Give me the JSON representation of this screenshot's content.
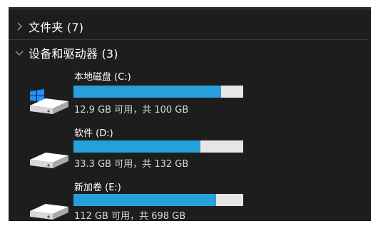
{
  "folders_group": {
    "label": "文件夹 (7)"
  },
  "devices_group": {
    "label": "设备和驱动器 (3)"
  },
  "colors": {
    "panel_bg": "#1d1d1d",
    "bar_fill": "#26a0da",
    "bar_bg": "#e6e6e6",
    "windows_logo": "#1e90ff"
  },
  "drives": [
    {
      "name": "本地磁盘 (C:)",
      "info": "12.9 GB 可用，共 100 GB",
      "used_fraction": 0.871,
      "icon": "system-drive-icon"
    },
    {
      "name": "软件 (D:)",
      "info": "33.3 GB 可用，共 132 GB",
      "used_fraction": 0.748,
      "icon": "drive-icon"
    },
    {
      "name": "新加卷 (E:)",
      "info": "112 GB 可用，共 698 GB",
      "used_fraction": 0.84,
      "icon": "drive-icon"
    }
  ]
}
